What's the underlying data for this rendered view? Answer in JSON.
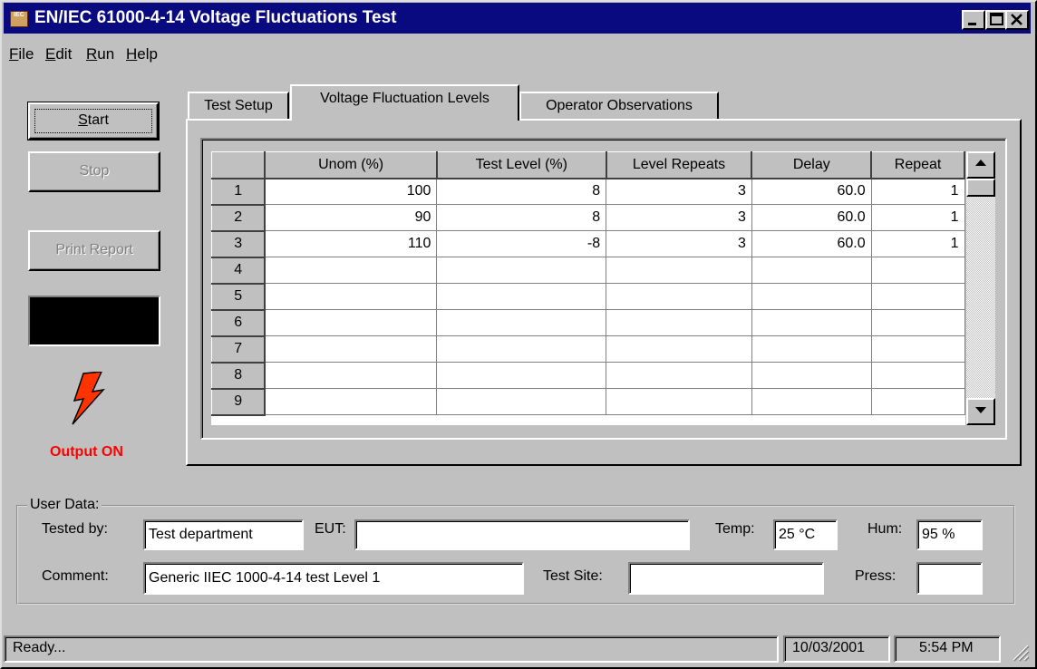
{
  "window": {
    "title": "EN/IEC 61000-4-14 Voltage Fluctuations Test",
    "icon_label": "IEC"
  },
  "menu": [
    {
      "label": "File",
      "accel": "F",
      "rest": "ile"
    },
    {
      "label": "Edit",
      "accel": "E",
      "rest": "dit"
    },
    {
      "label": "Run",
      "accel": "R",
      "rest": "un"
    },
    {
      "label": "Help",
      "accel": "H",
      "rest": "elp"
    }
  ],
  "buttons": {
    "start": {
      "accel": "S",
      "rest": "tart"
    },
    "stop": "Stop",
    "print_report": "Print Report"
  },
  "output_status": "Output ON",
  "tabs": [
    "Test Setup",
    "Voltage Fluctuation Levels",
    "Operator Observations"
  ],
  "active_tab": "Voltage Fluctuation Levels",
  "grid": {
    "columns": [
      "Unom (%)",
      "Test Level (%)",
      "Level Repeats",
      "Delay",
      "Repeat"
    ],
    "rows": [
      {
        "n": "1",
        "cells": [
          "100",
          "8",
          "3",
          "60.0",
          "1"
        ]
      },
      {
        "n": "2",
        "cells": [
          "90",
          "8",
          "3",
          "60.0",
          "1"
        ]
      },
      {
        "n": "3",
        "cells": [
          "110",
          "-8",
          "3",
          "60.0",
          "1"
        ]
      },
      {
        "n": "4",
        "cells": [
          "",
          "",
          "",
          "",
          ""
        ]
      },
      {
        "n": "5",
        "cells": [
          "",
          "",
          "",
          "",
          ""
        ]
      },
      {
        "n": "6",
        "cells": [
          "",
          "",
          "",
          "",
          ""
        ]
      },
      {
        "n": "7",
        "cells": [
          "",
          "",
          "",
          "",
          ""
        ]
      },
      {
        "n": "8",
        "cells": [
          "",
          "",
          "",
          "",
          ""
        ]
      },
      {
        "n": "9",
        "cells": [
          "",
          "",
          "",
          "",
          ""
        ]
      }
    ]
  },
  "user_data": {
    "group_label": "User Data:",
    "tested_by_label": "Tested by:",
    "tested_by": "Test department",
    "eut_label": "EUT:",
    "eut": "",
    "temp_label": "Temp:",
    "temp": "25 °C",
    "hum_label": "Hum:",
    "hum": "95 %",
    "comment_label": "Comment:",
    "comment": "Generic IIEC 1000-4-14 test Level 1",
    "test_site_label": "Test Site:",
    "test_site": "",
    "press_label": "Press:",
    "press": ""
  },
  "status_bar": {
    "message": "Ready...",
    "date": "10/03/2001",
    "time": "5:54 PM"
  },
  "colors": {
    "title_bar": "#0a0a80",
    "face": "#c0c0c0",
    "output_on": "#ff0000",
    "lightning": "#ff3300"
  }
}
